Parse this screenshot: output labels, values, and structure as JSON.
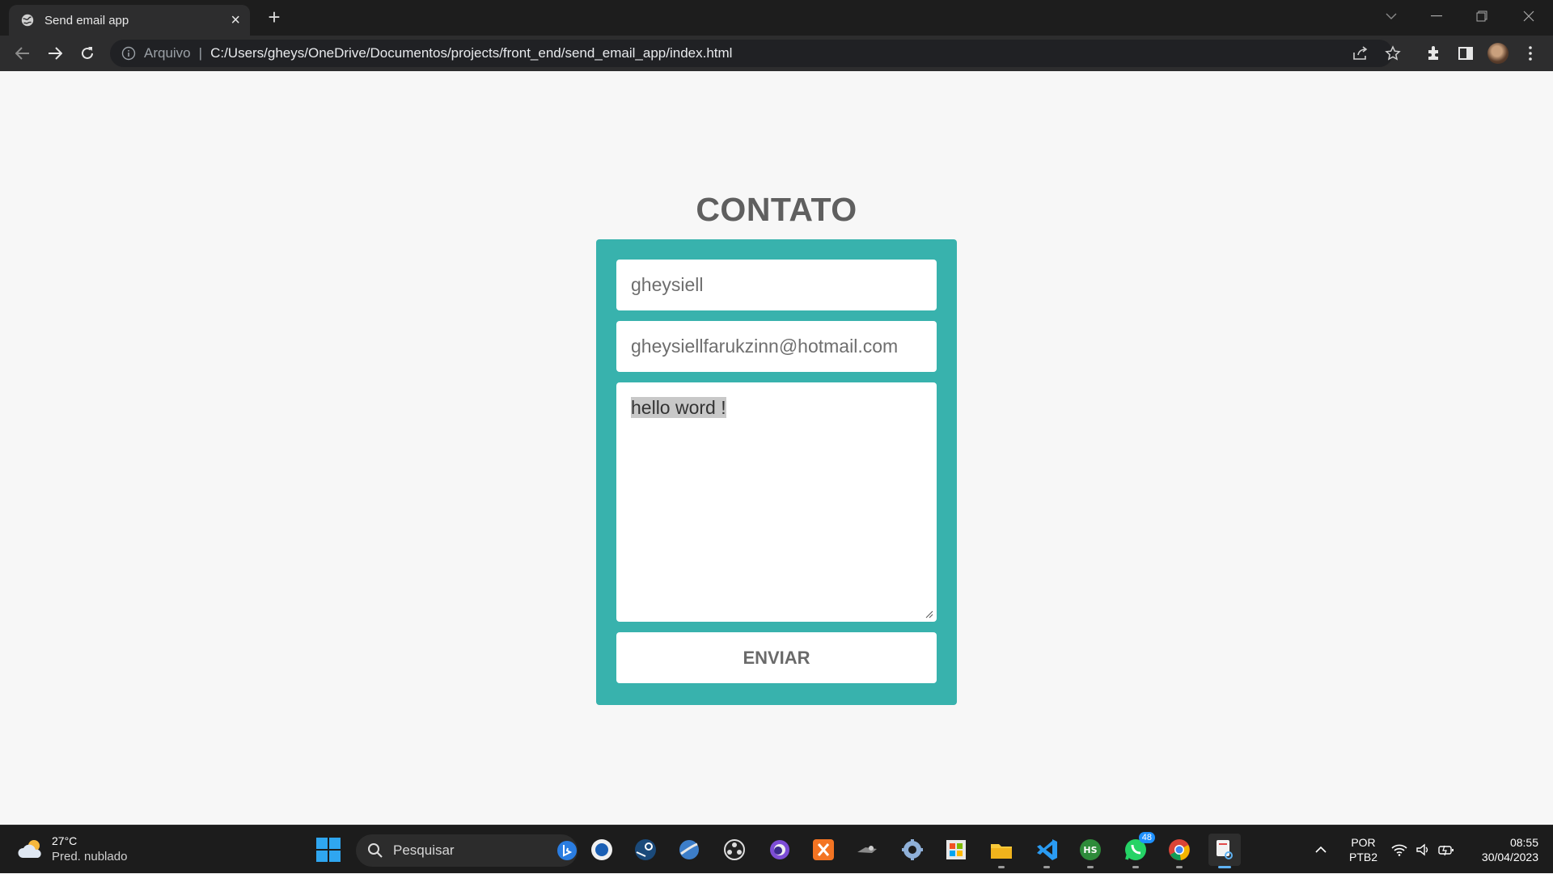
{
  "browser": {
    "tab_title": "Send email app",
    "tab_close": "×",
    "new_tab": "+",
    "scheme_label": "Arquivo",
    "separator": "|",
    "url": "C:/Users/gheys/OneDrive/Documentos/projects/front_end/send_email_app/index.html"
  },
  "page": {
    "heading": "CONTATO",
    "form": {
      "name_value": "gheysiell",
      "email_value": "gheysiellfarukzinn@hotmail.com",
      "message_value": "hello word !",
      "submit_label": "ENVIAR"
    },
    "colors": {
      "card": "#38b2ad",
      "background": "#f7f7f7",
      "heading": "#5f5f5f"
    }
  },
  "taskbar": {
    "weather_temp": "27°C",
    "weather_condition": "Pred. nublado",
    "search_placeholder": "Pesquisar",
    "whatsapp_badge": "48",
    "lang_line1": "POR",
    "lang_line2": "PTB2",
    "time": "08:55",
    "date": "30/04/2023"
  }
}
